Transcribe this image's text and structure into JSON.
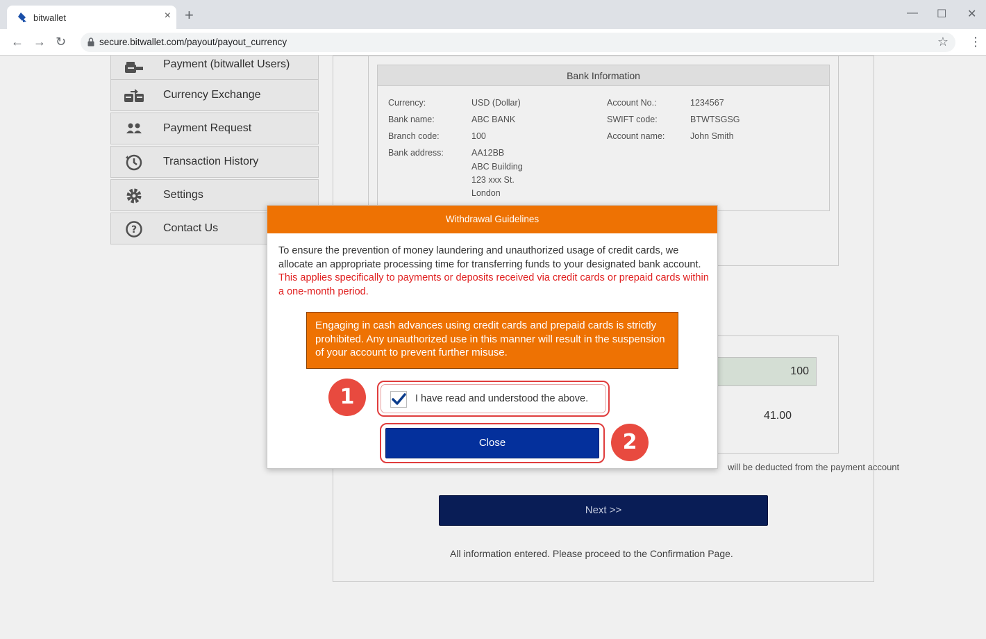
{
  "browser": {
    "tab_title": "bitwallet",
    "tab_close": "×",
    "new_tab": "+",
    "url": "secure.bitwallet.com/payout/payout_currency",
    "minimize": "—",
    "maximize": "☐",
    "close": "✕"
  },
  "sidebar": {
    "items": [
      {
        "label": "Payment (bitwallet Users)",
        "icon": "wallet-arrow-icon"
      },
      {
        "label": "Currency Exchange",
        "icon": "exchange-icon"
      },
      {
        "label": "Payment Request",
        "icon": "users-icon"
      },
      {
        "label": "Transaction History",
        "icon": "history-icon"
      },
      {
        "label": "Settings",
        "icon": "gear-icon"
      },
      {
        "label": "Contact Us",
        "icon": "question-icon"
      }
    ]
  },
  "bank": {
    "title": "Bank Information",
    "left": [
      {
        "label": "Currency:",
        "value": "USD (Dollar)"
      },
      {
        "label": "Bank name:",
        "value": "ABC BANK"
      },
      {
        "label": "Branch code:",
        "value": "100"
      },
      {
        "label": "Bank address:",
        "value": "AA12BB"
      }
    ],
    "address_lines": [
      "ABC Building",
      "123 xxx St.",
      "London"
    ],
    "right": [
      {
        "label": "Account No.:",
        "value": "1234567"
      },
      {
        "label": "SWIFT code:",
        "value": "BTWTSGSG"
      },
      {
        "label": "Account name:",
        "value": "John Smith"
      }
    ]
  },
  "form": {
    "amount_value": "100",
    "fee_value": "41.00",
    "fee_note": "will be deducted from the payment account",
    "next_label": "Next >>",
    "confirm_note": "All information entered. Please proceed to the Confirmation Page."
  },
  "modal": {
    "title": "Withdrawal Guidelines",
    "body_text": "To ensure the prevention of money laundering and unauthorized usage of credit cards, we allocate an appropriate processing time for transferring funds to your designated bank account. ",
    "body_red": "This applies specifically to payments or deposits received via credit cards or prepaid cards within a one-month period.",
    "warning": "Engaging in cash advances using credit cards and prepaid cards is strictly prohibited. Any unauthorized use in this manner will result in the suspension of your account to prevent further misuse.",
    "checkbox_label": "I have read and understood the above.",
    "checkbox_checked": true,
    "close_label": "Close",
    "step1": "1",
    "step2": "2"
  },
  "colors": {
    "modal_header": "#ee7203",
    "close_button": "#04309c",
    "step_badge": "#e84a3f",
    "red_text": "#e02020"
  }
}
